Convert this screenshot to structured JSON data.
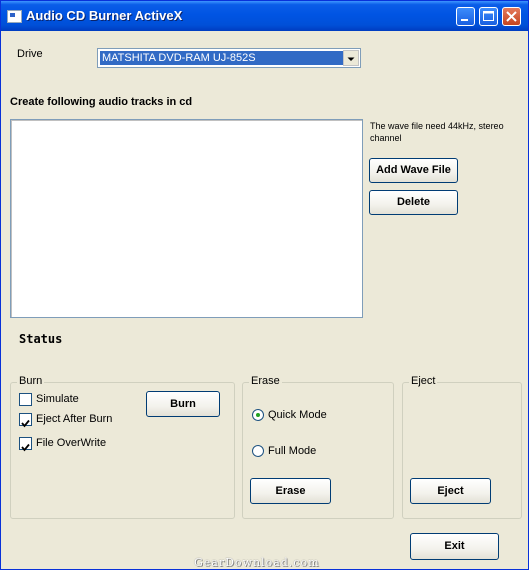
{
  "window": {
    "title": "Audio CD Burner ActiveX"
  },
  "drive": {
    "label": "Drive",
    "selected": "MATSHITA DVD-RAM UJ-852S"
  },
  "tracks": {
    "heading": "Create following audio tracks in cd",
    "note": [
      "The wave file need 44kHz, stereo",
      "channel"
    ],
    "add_label": "Add Wave File",
    "delete_label": "Delete"
  },
  "status": {
    "label": "Status"
  },
  "burn": {
    "caption": "Burn",
    "simulate_label": "Simulate",
    "simulate_checked": false,
    "eject_after_label": "Eject After Burn",
    "eject_after_checked": true,
    "overwrite_label": "File OverWrite",
    "overwrite_checked": true,
    "button_label": "Burn"
  },
  "erase": {
    "caption": "Erase",
    "quick_label": "Quick Mode",
    "quick_selected": true,
    "full_label": "Full Mode",
    "full_selected": false,
    "button_label": "Erase"
  },
  "eject": {
    "caption": "Eject",
    "button_label": "Eject"
  },
  "exit_label": "Exit",
  "watermark": "GearDownload.com"
}
